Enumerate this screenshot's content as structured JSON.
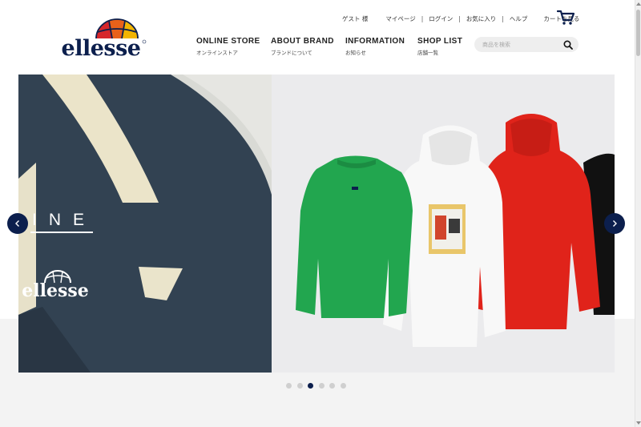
{
  "brand": {
    "logo_text": "ellesse",
    "colors": {
      "navy": "#0c1f4d",
      "orange": "#e8611a",
      "red": "#d6262b",
      "yellow": "#f2b400"
    }
  },
  "util_nav": {
    "guest": "ゲスト 様",
    "mypage": "マイページ",
    "login": "ログイン",
    "favorites": "お気に入り",
    "help": "ヘルプ",
    "cart_text": "カートを見る",
    "cart_icon": "cart-icon",
    "separator": "|"
  },
  "main_nav": [
    {
      "en": "ONLINE STORE",
      "jp": "オンラインストア"
    },
    {
      "en": "ABOUT BRAND",
      "jp": "ブランドについて"
    },
    {
      "en": "INFORMATION",
      "jp": "お知らせ"
    },
    {
      "en": "SHOP LIST",
      "jp": "店舗一覧"
    }
  ],
  "search": {
    "placeholder": "商品を検索",
    "icon": "search-icon"
  },
  "hero": {
    "word": "INE",
    "logo_text": "ellesse",
    "prev_icon": "chevron-left-icon",
    "next_icon": "chevron-right-icon"
  },
  "carousel": {
    "slide_count": 6,
    "active_index": 2
  }
}
